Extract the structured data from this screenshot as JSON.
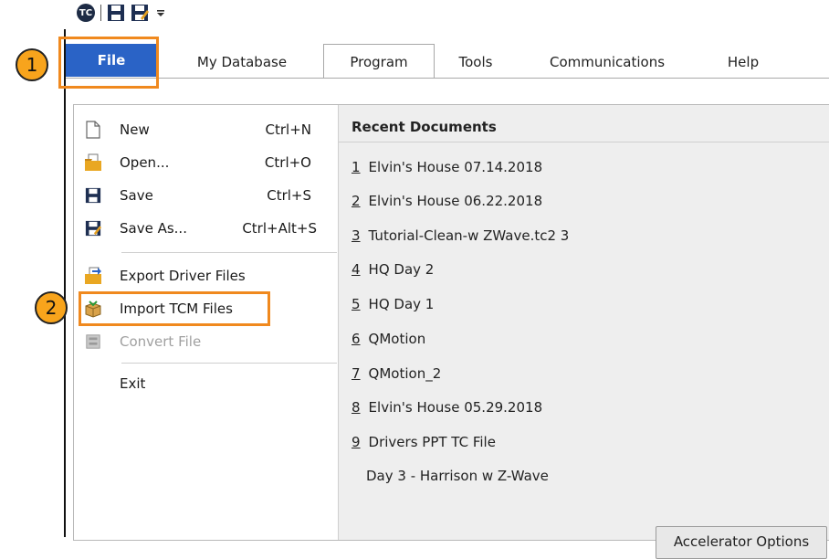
{
  "quick_access": {
    "app_logo_text": "TC"
  },
  "tabs": [
    {
      "label": "File"
    },
    {
      "label": "My Database"
    },
    {
      "label": "Program"
    },
    {
      "label": "Tools"
    },
    {
      "label": "Communications"
    },
    {
      "label": "Help"
    }
  ],
  "file_menu": {
    "items": [
      {
        "label": "New",
        "shortcut": "Ctrl+N",
        "icon": "new-document-icon"
      },
      {
        "label": "Open...",
        "shortcut": "Ctrl+O",
        "icon": "open-folder-icon"
      },
      {
        "label": "Save",
        "shortcut": "Ctrl+S",
        "icon": "save-icon"
      },
      {
        "label": "Save As...",
        "shortcut": "Ctrl+Alt+S",
        "icon": "save-as-icon"
      },
      {
        "label": "Export Driver Files",
        "icon": "export-icon"
      },
      {
        "label": "Import TCM Files",
        "icon": "import-box-icon"
      },
      {
        "label": "Convert File",
        "icon": "convert-icon",
        "disabled": true
      },
      {
        "label": "Exit"
      }
    ]
  },
  "recent_documents": {
    "heading": "Recent Documents",
    "items": [
      {
        "num": "1",
        "name": "Elvin's House 07.14.2018"
      },
      {
        "num": "2",
        "name": "Elvin's House 06.22.2018"
      },
      {
        "num": "3",
        "name": "Tutorial-Clean-w ZWave.tc2 3"
      },
      {
        "num": "4",
        "name": "HQ Day 2"
      },
      {
        "num": "5",
        "name": "HQ Day 1"
      },
      {
        "num": "6",
        "name": "QMotion"
      },
      {
        "num": "7",
        "name": "QMotion_2"
      },
      {
        "num": "8",
        "name": "Elvin's House 05.29.2018"
      },
      {
        "num": "9",
        "name": "Drivers PPT TC File"
      },
      {
        "num": "",
        "name": "Day 3 - Harrison w Z-Wave"
      }
    ]
  },
  "accelerator_button": "Accelerator Options",
  "callouts": [
    {
      "label": "1"
    },
    {
      "label": "2"
    }
  ],
  "colors": {
    "file_tab": "#2a63c6",
    "highlight": "#f0891e",
    "badge": "#f8a41c"
  }
}
